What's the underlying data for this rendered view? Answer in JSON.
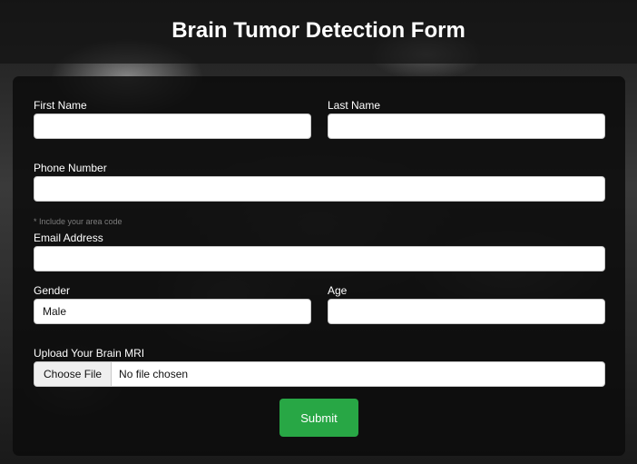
{
  "header": {
    "title": "Brain Tumor Detection Form"
  },
  "form": {
    "first_name": {
      "label": "First Name",
      "value": ""
    },
    "last_name": {
      "label": "Last Name",
      "value": ""
    },
    "phone": {
      "label": "Phone Number",
      "value": "",
      "hint": "* Include your area code"
    },
    "email": {
      "label": "Email Address",
      "value": ""
    },
    "gender": {
      "label": "Gender",
      "selected": "Male"
    },
    "age": {
      "label": "Age",
      "value": ""
    },
    "upload": {
      "label": "Upload Your Brain MRI",
      "button_label": "Choose File",
      "status": "No file chosen"
    },
    "submit_label": "Submit"
  },
  "colors": {
    "submit_bg": "#28a745",
    "card_bg": "#0c0c0c",
    "hint_text": "#7d7d7d"
  }
}
